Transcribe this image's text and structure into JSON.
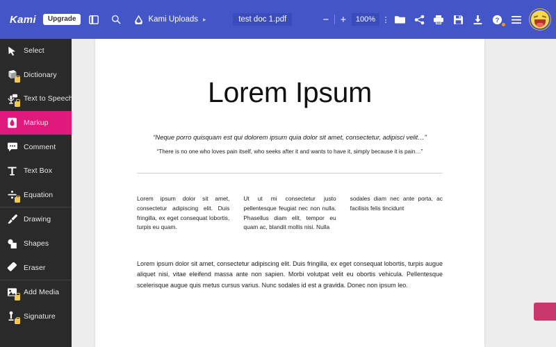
{
  "topbar": {
    "brand": "Kami",
    "upgrade_label": "Upgrade",
    "sidebar_toggle_icon": "panel-toggle-icon",
    "search_icon": "search-icon",
    "breadcrumb_icon": "kami-drop-icon",
    "breadcrumb_label": "Kami Uploads",
    "breadcrumb_arrow": "▸",
    "doc_title": "test doc 1.pdf",
    "zoom_out_label": "−",
    "zoom_in_label": "+",
    "zoom_value": "100%",
    "zoom_more_label": "⋮",
    "icons": [
      {
        "name": "open-folder-icon",
        "title": "Open"
      },
      {
        "name": "share-icon",
        "title": "Share"
      },
      {
        "name": "print-icon",
        "title": "Print"
      },
      {
        "name": "save-icon",
        "title": "Save"
      },
      {
        "name": "download-icon",
        "title": "Download"
      },
      {
        "name": "help-icon",
        "title": "Help"
      },
      {
        "name": "menu-icon",
        "title": "Menu"
      }
    ],
    "avatar_name": "user-avatar"
  },
  "sidebar": {
    "groups": [
      {
        "items": [
          {
            "label": "Select",
            "icon": "cursor-arrow-icon",
            "locked": false,
            "active": false
          },
          {
            "label": "Dictionary",
            "icon": "book-icon",
            "locked": true,
            "active": false
          },
          {
            "label": "Text to Speech",
            "icon": "speech-icon",
            "locked": true,
            "active": false
          },
          {
            "label": "Markup",
            "icon": "marker-icon",
            "locked": false,
            "active": true
          },
          {
            "label": "Comment",
            "icon": "comment-icon",
            "locked": false,
            "active": false
          },
          {
            "label": "Text Box",
            "icon": "text-box-icon",
            "locked": false,
            "active": false
          },
          {
            "label": "Equation",
            "icon": "equation-icon",
            "locked": true,
            "active": false
          }
        ]
      },
      {
        "items": [
          {
            "label": "Drawing",
            "icon": "brush-icon",
            "locked": false,
            "active": false
          },
          {
            "label": "Shapes",
            "icon": "shapes-icon",
            "locked": false,
            "active": false
          },
          {
            "label": "Eraser",
            "icon": "eraser-icon",
            "locked": false,
            "active": false
          }
        ]
      },
      {
        "items": [
          {
            "label": "Add Media",
            "icon": "add-media-icon",
            "locked": true,
            "active": false
          },
          {
            "label": "Signature",
            "icon": "signature-icon",
            "locked": true,
            "active": false
          }
        ]
      }
    ]
  },
  "markup_panel": {
    "tools": [
      {
        "name": "pen-tool",
        "icon": "pen-icon",
        "active": false
      },
      {
        "name": "highlighter-tool",
        "icon": "highlighter-icon",
        "active": true
      },
      {
        "name": "strikethrough-tool",
        "icon": "strikethrough-icon",
        "active": false
      },
      {
        "name": "underline-tool",
        "icon": "underline-icon",
        "active": false
      }
    ],
    "colors": [
      {
        "name": "yellow-swatch",
        "hex": "#edeb1a",
        "selected": false
      },
      {
        "name": "green-swatch",
        "hex": "#18e818",
        "selected": true
      },
      {
        "name": "magenta-swatch",
        "hex": "#f40f9b",
        "selected": true
      }
    ],
    "palette_icon": "color-palette-icon"
  },
  "document": {
    "title": "Lorem Ipsum",
    "quote_italic": "“Neque porro quisquam est qui dolorem ipsum quia dolor sit amet, consectetur, adipisci velit…”",
    "quote_plain": "“There is no one who loves pain itself, who seeks after it and wants to have it, simply because it is pain…”",
    "columns": [
      "Lorem ipsum dolor sit amet, consectetur adipiscing elit. Duis fringilla, ex eget consequat lobortis, turpis eu quam.",
      "Ut ut mi consectetur justo pellentesque feugiat nec non nulla. Phasellus diam elit, tempor eu quam ac, blandit mollis nisi. Nulla",
      "sodales diam nec ante porta, ac facilisis felis tincidunt"
    ],
    "bottom_paragraph": "Lorem ipsum dolor sit amet, consectetur adipiscing elit. Duis fringilla, ex eget consequat lobortis, turpis augue aliquet nisi, vitae eleifend massa ante non sapien. Morbi volutpat velit eu obortis vehicula. Pellentesque scelerisque augue quis metus cursus varius. Nunc sodales id est a gravida. Donec non ipsum leo."
  },
  "colors": {
    "topbar": "#4355c7",
    "accent_pink": "#e0197d",
    "sidebar_bg": "#2a2a2a",
    "doc_bg": "#ededed"
  }
}
